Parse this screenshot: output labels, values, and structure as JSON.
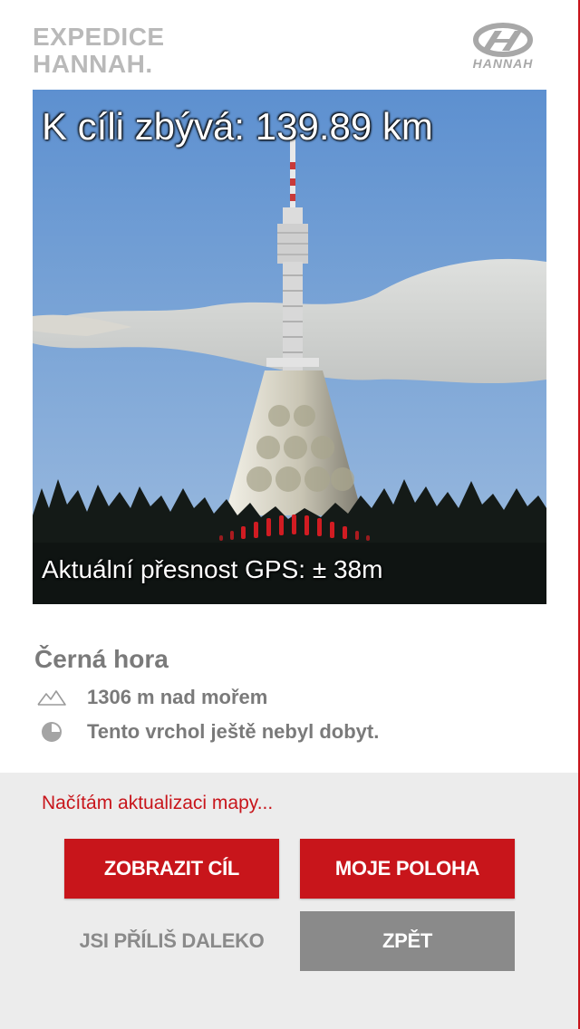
{
  "header": {
    "title_line1": "EXPEDICE",
    "title_line2": "HANNAH.",
    "logo_text": "HANNAH"
  },
  "photo": {
    "distance_text": "K cíli zbývá: 139.89 km",
    "gps_text": "Aktuální přesnost GPS: ± 38m",
    "gps_signal_level": 0.5
  },
  "peak": {
    "name": "Černá hora",
    "altitude": "1306 m nad mořem",
    "status": "Tento vrchol ještě nebyl dobyt.",
    "altitude_icon": "mountain-icon",
    "status_icon": "clock-icon"
  },
  "footer": {
    "loading_text": "Načítám aktualizaci mapy...",
    "buttons": {
      "show_target": "ZOBRAZIT CÍL",
      "my_location": "MOJE POLOHA",
      "too_far": "JSI PŘÍLIŠ DALEKO",
      "back": "ZPĚT"
    }
  },
  "colors": {
    "accent": "#c8151b",
    "grey_text": "#7a7a7a",
    "panel_bg": "#ececec",
    "grey_button": "#8a8a8a"
  }
}
